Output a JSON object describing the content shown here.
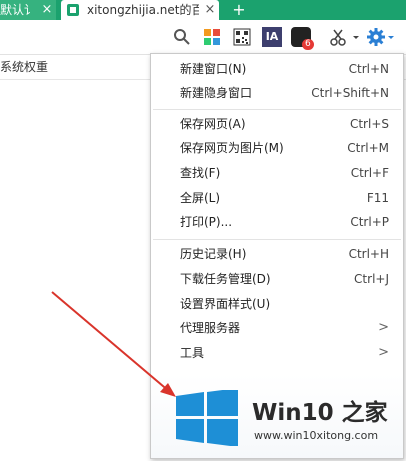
{
  "tabs": [
    {
      "label": "默认讠",
      "close": "×"
    },
    {
      "label": "xitongzhijia.net的百",
      "close": "×"
    }
  ],
  "new_tab": "+",
  "toolbar": {
    "icons": [
      "search-icon",
      "apps-grid-icon",
      "qr-code-icon",
      "ia-icon",
      "extension-icon",
      "scissors-icon",
      "dropdown-arrow-icon",
      "gear-icon"
    ],
    "extension_badge": "6",
    "ia_text": "IA"
  },
  "subbar": {
    "text": "系统权重"
  },
  "menu": {
    "items": [
      {
        "label": "新建窗口(N)",
        "shortcut": "Ctrl+N"
      },
      {
        "label": "新建隐身窗口",
        "shortcut": "Ctrl+Shift+N"
      },
      {
        "label": "保存网页(A)",
        "shortcut": "Ctrl+S"
      },
      {
        "label": "保存网页为图片(M)",
        "shortcut": "Ctrl+M"
      },
      {
        "label": "查找(F)",
        "shortcut": "Ctrl+F"
      },
      {
        "label": "全屏(L)",
        "shortcut": "F11"
      },
      {
        "label": "打印(P)...",
        "shortcut": "Ctrl+P"
      },
      {
        "label": "历史记录(H)",
        "shortcut": "Ctrl+H"
      },
      {
        "label": "下载任务管理(D)",
        "shortcut": "Ctrl+J"
      },
      {
        "label": "设置界面样式(U)",
        "shortcut": ""
      },
      {
        "label": "代理服务器",
        "shortcut": "",
        "submenu": ">"
      },
      {
        "label": "工具",
        "shortcut": "",
        "submenu": ">"
      }
    ]
  },
  "watermark": {
    "title": "Win10 之家",
    "url": "www.win10xitong.com"
  },
  "colors": {
    "tab_bar": "#1ba26e",
    "gear": "#2a7fd4",
    "arrow": "#d9342b",
    "win_logo": "#1e8fd6"
  }
}
